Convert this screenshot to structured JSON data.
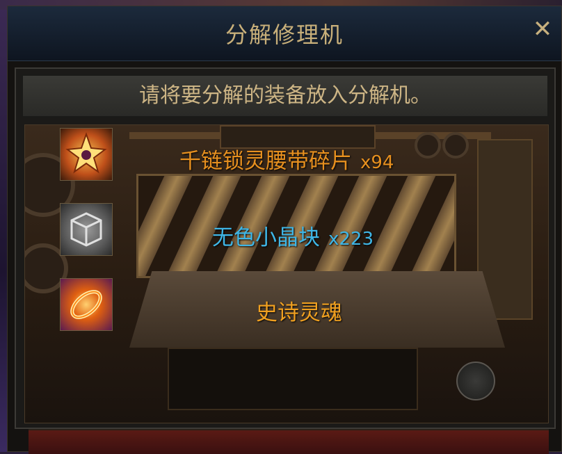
{
  "window": {
    "title": "分解修理机",
    "close_label": "✕",
    "instruction": "请将要分解的装备放入分解机。"
  },
  "items": [
    {
      "name": "千链锁灵腰带碎片",
      "qty": "x94",
      "color": "#e7901f",
      "icon": "belt-fragment-icon"
    },
    {
      "name": "无色小晶块",
      "qty": "x223",
      "color": "#3fb6e6",
      "icon": "colorless-crystal-icon"
    },
    {
      "name": "史诗灵魂",
      "qty": "",
      "color": "#f0a020",
      "icon": "epic-soul-icon"
    }
  ],
  "colors": {
    "title": "#c9b07a",
    "instruction": "#cdb585"
  }
}
